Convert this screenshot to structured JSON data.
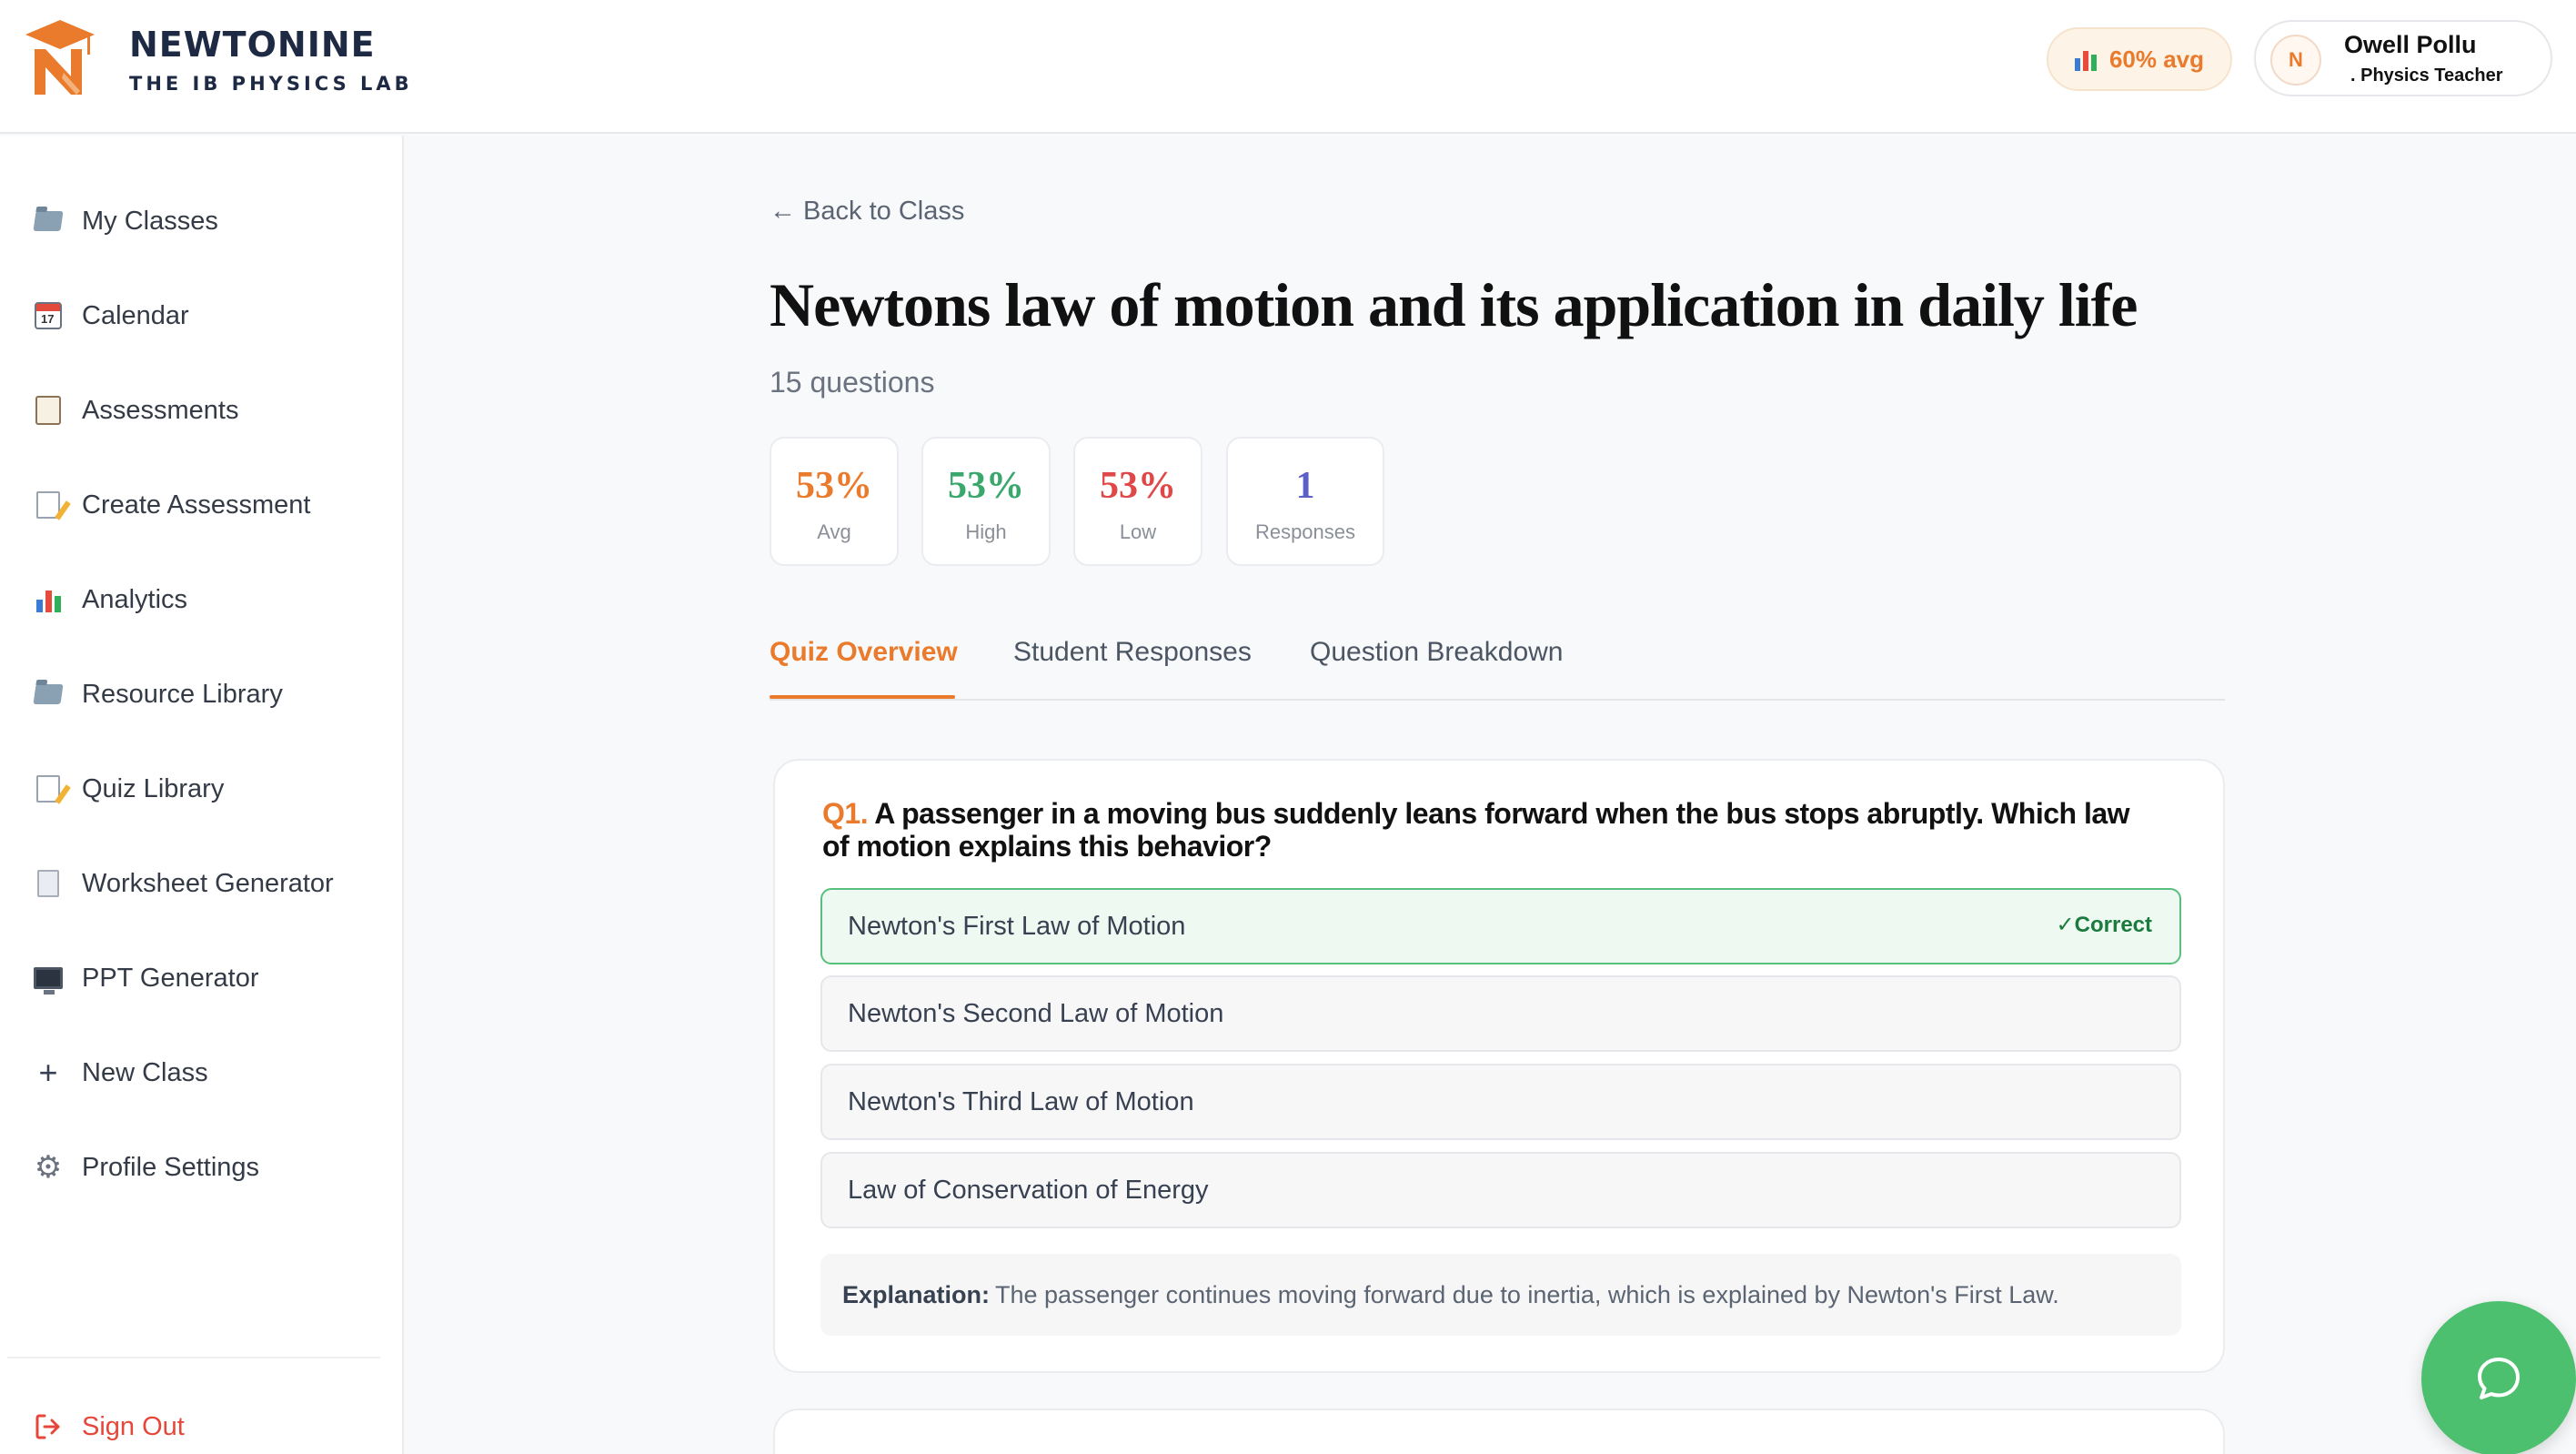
{
  "brand": {
    "name": "NEWTONINE",
    "subtitle": "THE IB PHYSICS LAB",
    "colors": {
      "primary": "#ea7a2c",
      "navy": "#1e2a44",
      "success": "#4cc06f"
    }
  },
  "header": {
    "avg_pill": "60% avg",
    "user": {
      "name": "Owell Pollu",
      "role": ". Physics Teacher"
    }
  },
  "sidebar": {
    "items": [
      {
        "label": "My Classes",
        "icon": "folder-icon"
      },
      {
        "label": "Calendar",
        "icon": "calendar-icon"
      },
      {
        "label": "Assessments",
        "icon": "clipboard-icon"
      },
      {
        "label": "Create Assessment",
        "icon": "memo-icon"
      },
      {
        "label": "Analytics",
        "icon": "bar-chart-icon"
      },
      {
        "label": "Resource Library",
        "icon": "folder-icon"
      },
      {
        "label": "Quiz Library",
        "icon": "memo-icon"
      },
      {
        "label": "Worksheet Generator",
        "icon": "page-icon"
      },
      {
        "label": "PPT Generator",
        "icon": "monitor-icon"
      },
      {
        "label": "New Class",
        "icon": "plus-icon"
      },
      {
        "label": "Profile Settings",
        "icon": "gear-icon"
      }
    ],
    "sign_out": "Sign Out"
  },
  "main": {
    "back_link": "← Back to Class",
    "title": "Newtons law of motion and its application in daily life",
    "question_count": "15 questions",
    "stats": [
      {
        "value": "53%",
        "label": "Avg",
        "color": "#ea7a2c"
      },
      {
        "value": "53%",
        "label": "High",
        "color": "#3aa76d"
      },
      {
        "value": "53%",
        "label": "Low",
        "color": "#e04848"
      },
      {
        "value": "1",
        "label": "Responses",
        "color": "#5b5fc7"
      }
    ],
    "tabs": [
      {
        "label": "Quiz Overview",
        "active": true
      },
      {
        "label": "Student Responses",
        "active": false
      },
      {
        "label": "Question Breakdown",
        "active": false
      }
    ],
    "question": {
      "number": "Q1.",
      "text": "A passenger in a moving bus suddenly leans forward when the bus stops abruptly. Which law of motion explains this behavior?",
      "options": [
        "Newton's First Law of Motion",
        "Newton's Second Law of Motion",
        "Newton's Third Law of Motion",
        "Law of Conservation of Energy"
      ],
      "correct_badge": "✓Correct",
      "explanation_label": "Explanation:",
      "explanation": "The passenger continues moving forward due to inertia, which is explained by Newton's First Law."
    }
  }
}
